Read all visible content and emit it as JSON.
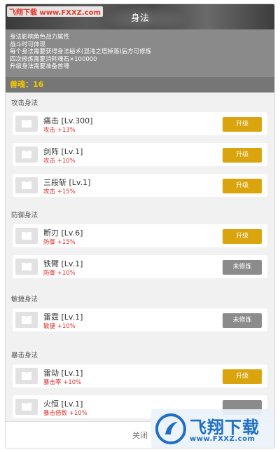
{
  "watermark_top": "飞翔下载 www.FXXZ.com",
  "header": {
    "title": "身法"
  },
  "info_lines": [
    "身法影响角色战力属性",
    "战斗时可体现",
    "每个身法需要获得身法秘术(混沌之塔掉落)后方可修炼",
    "四次修炼需要消耗魂石×100000",
    "升级身法需要准备兽魂"
  ],
  "soul": {
    "label": "兽魂：16"
  },
  "sections": [
    {
      "title": "攻击身法",
      "skills": [
        {
          "name": "痛击 [Lv.300]",
          "stat": "攻击 +13%",
          "button": "升级",
          "state": "upgrade"
        },
        {
          "name": "剑阵 [Lv.1]",
          "stat": "攻击 +10%",
          "button": "升级",
          "state": "upgrade"
        },
        {
          "name": "三段斩 [Lv.1]",
          "stat": "攻击 +15%",
          "button": "升级",
          "state": "upgrade"
        }
      ]
    },
    {
      "title": "防御身法",
      "skills": [
        {
          "name": "断刃 [Lv.6]",
          "stat": "防御 +15%",
          "button": "升级",
          "state": "upgrade"
        },
        {
          "name": "铁臂 [Lv.1]",
          "stat": "防御 +10%",
          "button": "未修炼",
          "state": "locked"
        }
      ]
    },
    {
      "title": "敏捷身法",
      "skills": [
        {
          "name": "雷霆 [Lv.1]",
          "stat": "敏捷 +10%",
          "button": "未修炼",
          "state": "locked"
        }
      ]
    },
    {
      "title": "暴击身法",
      "skills": [
        {
          "name": "雷动 [Lv.1]",
          "stat": "暴击率 +10%",
          "button": "升级",
          "state": "upgrade"
        },
        {
          "name": "火恒 [Lv.1]",
          "stat": "暴击倍数 +10%",
          "button": "",
          "state": "locked"
        }
      ]
    }
  ],
  "footer": {
    "close_label": "关闭"
  },
  "watermark_br": {
    "brand": "飞翔下载",
    "url": "www.FXXZ.com"
  },
  "colors": {
    "upgrade": "#d9a40d",
    "locked": "#8b8b8b",
    "stat": "#d9302c",
    "soul": "#f5c800"
  }
}
